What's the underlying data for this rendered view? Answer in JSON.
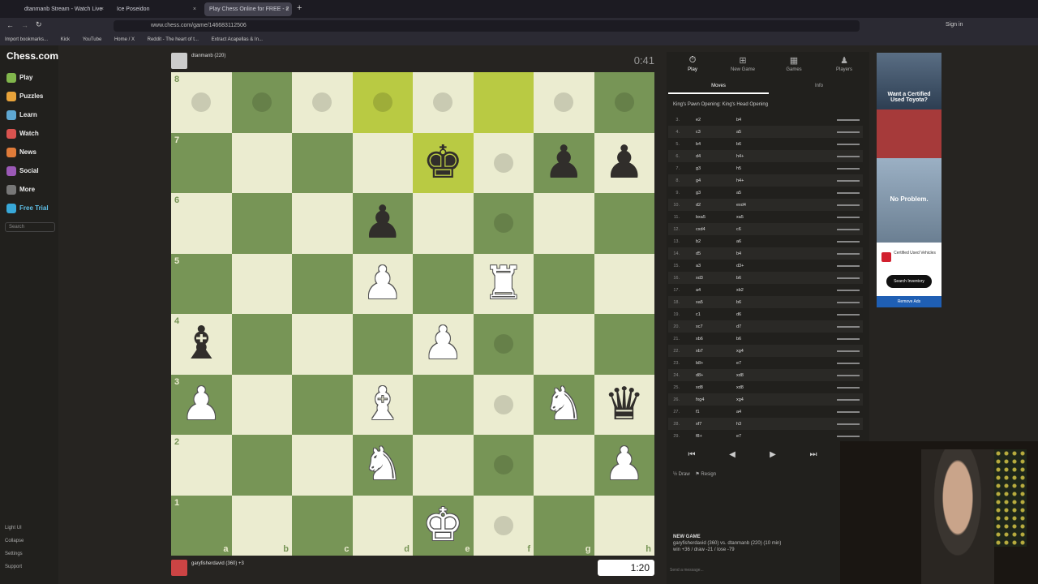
{
  "browser": {
    "tabs": [
      {
        "label": "dtanmanb Stream - Watch Live",
        "active": false
      },
      {
        "label": "Ice Poseidon",
        "active": false
      },
      {
        "label": "Play Chess Online for FREE - 2",
        "active": true
      }
    ],
    "url": "www.chess.com/game/146683112506",
    "sign_in": "Sign in",
    "bookmarks": [
      "Import bookmarks...",
      "Kick",
      "YouTube",
      "Home / X",
      "Reddit - The heart of t...",
      "Extract Acapellas & In..."
    ]
  },
  "site": {
    "logo": "Chess.com",
    "nav": [
      "Play",
      "Puzzles",
      "Learn",
      "Watch",
      "News",
      "Social",
      "More",
      "Free Trial"
    ],
    "search_placeholder": "Search",
    "bottom_nav": [
      "Light UI",
      "Collapse",
      "Settings",
      "Support"
    ]
  },
  "players": {
    "top": {
      "name": "dtanmanb",
      "rating": "(220)",
      "clock": "0:41"
    },
    "bottom": {
      "name": "garyfisherdavid",
      "rating": "(360)",
      "clock": "1:20",
      "extra": "+3"
    }
  },
  "board": {
    "files": [
      "a",
      "b",
      "c",
      "d",
      "e",
      "f",
      "g",
      "h"
    ],
    "ranks": [
      "8",
      "7",
      "6",
      "5",
      "4",
      "3",
      "2",
      "1"
    ],
    "pieces": {
      "e7": "bk",
      "g7": "bp",
      "h7": "bp",
      "d6": "bp",
      "d5": "wp",
      "f5": "wr",
      "a4": "bb",
      "e4": "wp",
      "a3": "wp",
      "d3": "wb",
      "g3": "wn",
      "h3": "bq",
      "d2": "wn",
      "h2": "wp",
      "e1": "wk"
    },
    "highlights": [
      "d8",
      "f8",
      "e7"
    ],
    "dots": [
      "a8",
      "b8",
      "c8",
      "d8",
      "e8",
      "g8",
      "h8",
      "f7",
      "f6",
      "f4",
      "f3",
      "f2",
      "f1"
    ]
  },
  "panel": {
    "tabs": [
      "Play",
      "New Game",
      "Games",
      "Players"
    ],
    "subtabs": [
      "Moves",
      "Info"
    ],
    "opening": "King's Pawn Opening: King's Head Opening",
    "moves": [
      [
        "3.",
        "e2",
        "b4"
      ],
      [
        "4.",
        "c3",
        "a5"
      ],
      [
        "5.",
        "b4",
        "b6"
      ],
      [
        "6.",
        "d4",
        "h4+"
      ],
      [
        "7.",
        "g3",
        "h5"
      ],
      [
        "8.",
        "g4",
        "h4+"
      ],
      [
        "9.",
        "g3",
        "a5"
      ],
      [
        "10.",
        "d2",
        "exd4"
      ],
      [
        "11.",
        "bxa5",
        "xa5"
      ],
      [
        "12.",
        "cxd4",
        "c6"
      ],
      [
        "13.",
        "b2",
        "a6"
      ],
      [
        "14.",
        "d5",
        "b4"
      ],
      [
        "15.",
        "a3",
        "d3+"
      ],
      [
        "16.",
        "xd3",
        "b6"
      ],
      [
        "17.",
        "a4",
        "xb2"
      ],
      [
        "18.",
        "xa5",
        "b6"
      ],
      [
        "19.",
        "c1",
        "d6"
      ],
      [
        "20.",
        "xc7",
        "d7"
      ],
      [
        "21.",
        "xb6",
        "b6"
      ],
      [
        "22.",
        "xb7",
        "xg4"
      ],
      [
        "23.",
        "b8+",
        "e7"
      ],
      [
        "24.",
        "d8+",
        "xd8"
      ],
      [
        "25.",
        "xd8",
        "xd8"
      ],
      [
        "26.",
        "fxg4",
        "xg4"
      ],
      [
        "27.",
        "f1",
        "a4"
      ],
      [
        "28.",
        "xf7",
        "h3"
      ],
      [
        "29.",
        "f8+",
        "e7"
      ]
    ],
    "controls": [
      "⏮",
      "◀",
      "▶",
      "⏭"
    ],
    "draw": "Draw",
    "resign": "Resign",
    "new_game_title": "NEW GAME",
    "new_game_line1": "garyfisherdavid (360) vs. dtanmanb (220) (10 min)",
    "new_game_line2": "win +36 / draw -21 / lose -79",
    "send_message": "Send a message..."
  },
  "ad": {
    "headline1": "Want a Certified Used Toyota?",
    "headline2": "No Problem.",
    "badge": "Certified Used Vehicles",
    "cta": "Search Inventory",
    "remove": "Remove Ads"
  },
  "colors": {
    "light_square": "#ebecd0",
    "dark_square": "#779556",
    "highlight": "#b9ca43",
    "bg": "#262421"
  }
}
